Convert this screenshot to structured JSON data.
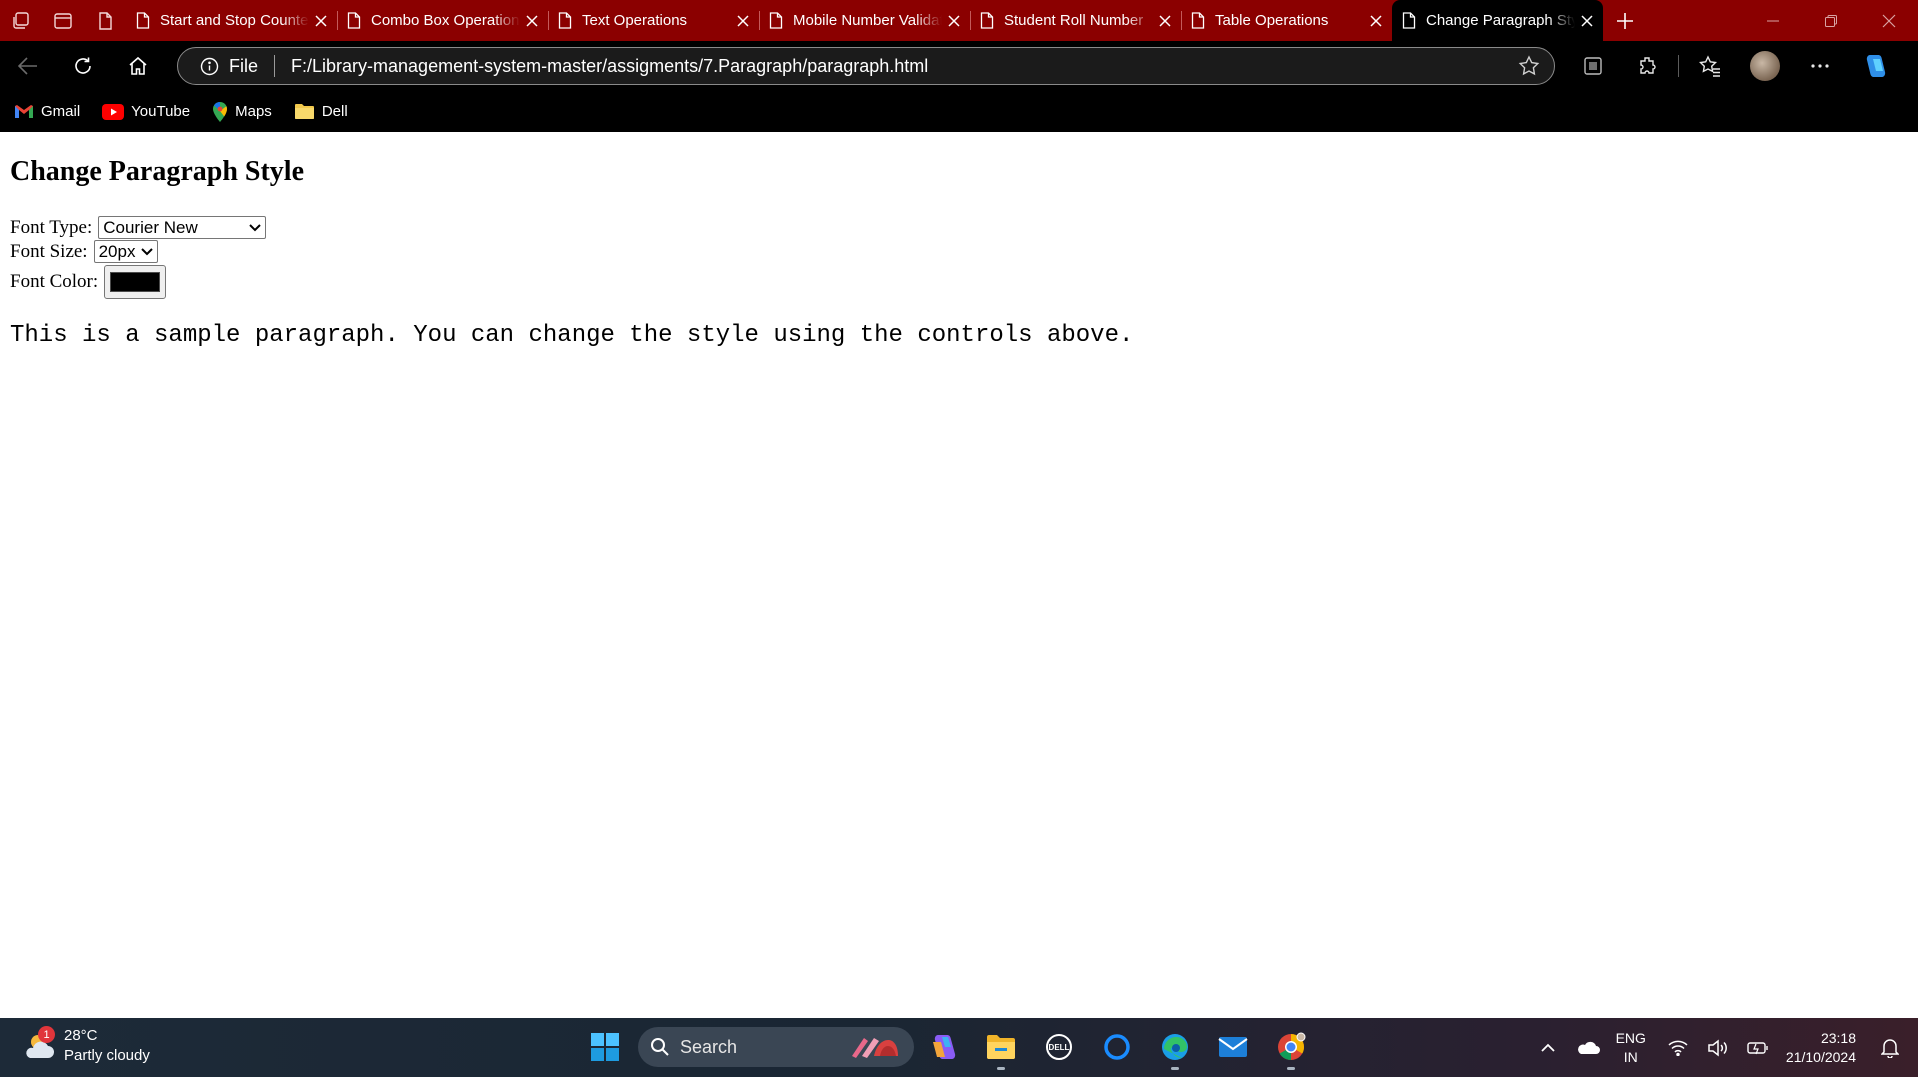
{
  "browser": {
    "tabs": [
      {
        "title": "Start and Stop Counter"
      },
      {
        "title": "Combo Box Operations"
      },
      {
        "title": "Text Operations"
      },
      {
        "title": "Mobile Number Validation"
      },
      {
        "title": "Student Roll Number"
      },
      {
        "title": "Table Operations"
      },
      {
        "title": "Change Paragraph Style",
        "active": true
      }
    ],
    "address": {
      "scheme_label": "File",
      "url": "F:/Library-management-system-master/assigments/7.Paragraph/paragraph.html"
    },
    "bookmarks": [
      {
        "label": "Gmail",
        "icon": "gmail-icon"
      },
      {
        "label": "YouTube",
        "icon": "youtube-icon"
      },
      {
        "label": "Maps",
        "icon": "maps-icon"
      },
      {
        "label": "Dell",
        "icon": "folder-icon"
      }
    ]
  },
  "page": {
    "heading": "Change Paragraph Style",
    "font_type": {
      "label": "Font Type:",
      "value": "Courier New"
    },
    "font_size": {
      "label": "Font Size:",
      "value": "20px"
    },
    "font_color": {
      "label": "Font Color:",
      "value": "#000000"
    },
    "paragraph": "This is a sample paragraph. You can change the style using the controls above."
  },
  "taskbar": {
    "weather": {
      "temp": "28°C",
      "condition": "Partly cloudy",
      "badge": "1"
    },
    "search_placeholder": "Search",
    "language": {
      "line1": "ENG",
      "line2": "IN"
    },
    "clock": {
      "time": "23:18",
      "date": "21/10/2024"
    }
  },
  "colors": {
    "tabstrip": "#8b0000",
    "toolbar": "#000000",
    "page_bg": "#ffffff"
  }
}
